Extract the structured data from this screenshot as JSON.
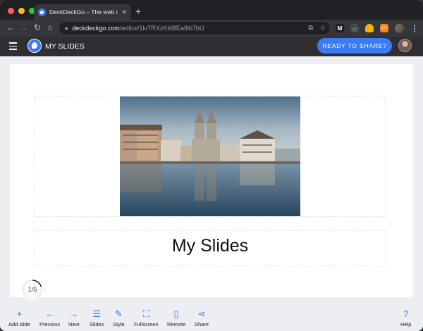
{
  "browser": {
    "tab_title": "DeckDeckGo – The web open so",
    "url_host": "deckdeckgo.com",
    "url_path": "/editor/1lvTRXzKtiiBEa9lb7bU"
  },
  "app": {
    "title": "MY SLIDES",
    "ready_button": "READY TO SHARE?"
  },
  "slide": {
    "title": "My Slides",
    "counter": "1/5",
    "progress": 0.2
  },
  "toolbar": {
    "items": [
      {
        "label": "Add slide",
        "icon": "plus-icon"
      },
      {
        "label": "Previous",
        "icon": "arrow-left-icon"
      },
      {
        "label": "Next",
        "icon": "arrow-right-icon"
      },
      {
        "label": "Slides",
        "icon": "list-icon"
      },
      {
        "label": "Style",
        "icon": "brush-icon"
      },
      {
        "label": "Fullscreen",
        "icon": "fullscreen-icon"
      },
      {
        "label": "Remote",
        "icon": "mobile-icon"
      },
      {
        "label": "Share",
        "icon": "share-icon"
      },
      {
        "label": "Help",
        "icon": "help-icon"
      }
    ]
  },
  "colors": {
    "accent": "#3a7bf7",
    "appbar": "#2f2f31"
  }
}
